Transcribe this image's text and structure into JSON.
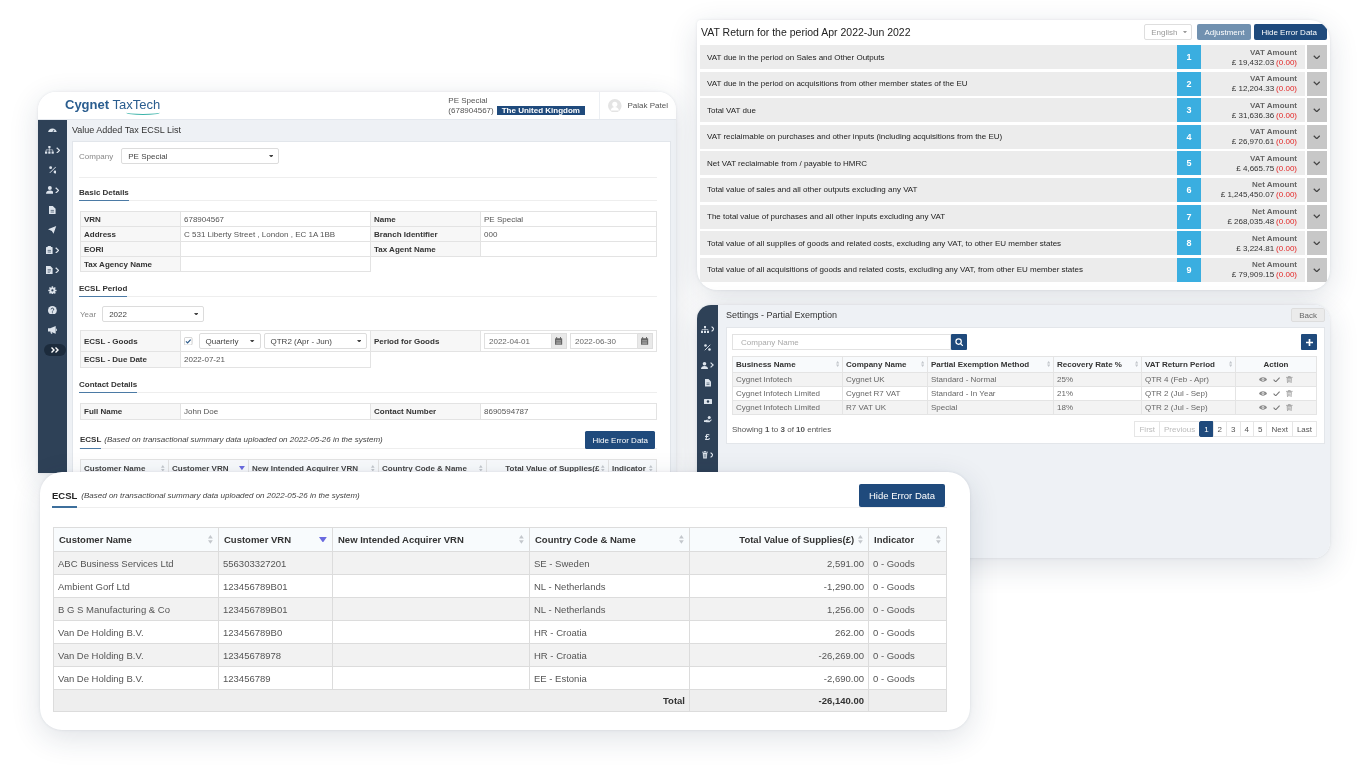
{
  "vat_return": {
    "title": "VAT Return for the period Apr 2022-Jun 2022",
    "language": "English",
    "buttons": [
      {
        "label": "Adjustment",
        "kind": "secondary"
      },
      {
        "label": "Hide Error Data",
        "kind": "primary"
      }
    ],
    "boxes": [
      {
        "description": "VAT due in the period on Sales and Other Outputs",
        "number": "1",
        "amount_label": "VAT Amount",
        "amount": "£ 19,432.03",
        "error": "(0.00)"
      },
      {
        "description": "VAT due in the period on acquisitions from other member states of the EU",
        "number": "2",
        "amount_label": "VAT Amount",
        "amount": "£ 12,204.33",
        "error": "(0.00)"
      },
      {
        "description": "Total VAT due",
        "number": "3",
        "amount_label": "VAT Amount",
        "amount": "£ 31,636.36",
        "error": "(0.00)"
      },
      {
        "description": "VAT reclaimable on purchases and other inputs (including acquisitions from the EU)",
        "number": "4",
        "amount_label": "VAT Amount",
        "amount": "£ 26,970.61",
        "error": "(0.00)"
      },
      {
        "description": "Net VAT reclaimable from / payable to HMRC",
        "number": "5",
        "amount_label": "VAT Amount",
        "amount": "£ 4,665.75",
        "error": "(0.00)"
      },
      {
        "description": "Total value of sales and all other outputs excluding any VAT",
        "number": "6",
        "amount_label": "Net Amount",
        "amount": "£ 1,245,450.07",
        "error": "(0.00)"
      },
      {
        "description": "The total value of purchases and all other inputs excluding any VAT",
        "number": "7",
        "amount_label": "Net Amount",
        "amount": "£ 268,035.48",
        "error": "(0.00)"
      },
      {
        "description": "Total value of all supplies of goods and related costs, excluding any VAT, to other EU member states",
        "number": "8",
        "amount_label": "Net Amount",
        "amount": "£ 3,224.81",
        "error": "(0.00)"
      },
      {
        "description": "Total value of all acquisitions of goods and related costs, excluding any VAT, from other EU member states",
        "number": "9",
        "amount_label": "Net Amount",
        "amount": "£ 79,909.15",
        "error": "(0.00)"
      }
    ]
  },
  "main_window": {
    "header": {
      "logo": "**Cygnet** TaxTech",
      "company": "PE Special",
      "company_id": "(678904567)",
      "country": "The United Kingdom",
      "user": "Palak Patel"
    },
    "sidebar": [
      {
        "kind": "gauge",
        "submenu": false
      },
      {
        "kind": "sitemap",
        "submenu": true
      },
      {
        "kind": "percent",
        "submenu": false
      },
      {
        "kind": "user",
        "submenu": true
      },
      {
        "kind": "document",
        "submenu": false
      },
      {
        "kind": "plane",
        "submenu": false
      },
      {
        "kind": "clipboard",
        "submenu": true
      },
      {
        "kind": "file",
        "submenu": true
      },
      {
        "kind": "gear",
        "submenu": false
      },
      {
        "kind": "help",
        "submenu": false
      },
      {
        "kind": "megaphone",
        "submenu": false
      },
      {
        "kind": "expand",
        "submenu": false
      }
    ],
    "title": "Value Added Tax ECSL List",
    "company": {
      "label": "Company",
      "value": "PE Special"
    },
    "basic_details": {
      "heading": "Basic Details",
      "fields": [
        {
          "label": "VRN",
          "value": "678904567"
        },
        {
          "label": "Name",
          "value": "PE Special"
        },
        {
          "label": "Address",
          "value": "C 531 Liberty Street , London , EC 1A 1BB"
        },
        {
          "label": "Branch Identifier",
          "value": "000"
        },
        {
          "label": "EORI"
        },
        {
          "label": "Tax Agent Name"
        },
        {
          "label": "Tax Agency Name"
        }
      ]
    },
    "ecsl_period": {
      "heading": "ECSL Period",
      "year": {
        "label": "Year",
        "value": "2022"
      },
      "goods": {
        "label": "ECSL - Goods",
        "checked": true,
        "frequency": "Quarterly",
        "quarter": "QTR2 (Apr - Jun)",
        "period_label": "Period for Goods",
        "from": "2022-04-01",
        "to": "2022-06-30"
      },
      "due_date": {
        "label": "ECSL - Due Date",
        "value": "2022-07-21"
      }
    },
    "contact_details": {
      "heading": "Contact Details",
      "fields": [
        {
          "label": "Full Name",
          "value": "John Doe"
        },
        {
          "label": "Contact Number",
          "value": "8690594787"
        }
      ]
    },
    "ecsl": {
      "heading": "ECSL",
      "note": "(Based on transactional summary data uploaded on 2022-05-26 in the system)",
      "button": "Hide Error Data",
      "columns": [
        {
          "label": "Customer Name",
          "sortable": true,
          "sorted": false
        },
        {
          "label": "Customer VRN",
          "sortable": true,
          "sorted": true
        },
        {
          "label": "New Intended Acquirer VRN",
          "sortable": true,
          "sorted": false
        },
        {
          "label": "Country Code & Name",
          "sortable": true,
          "sorted": false
        },
        {
          "label": "Total Value of Supplies(£",
          "sortable": true,
          "sorted": false
        },
        {
          "label": "Indicator",
          "sortable": true,
          "sorted": false
        }
      ]
    }
  },
  "partial_exemption": {
    "sidebar": [
      {
        "kind": "sitemap",
        "submenu": true
      },
      {
        "kind": "percent",
        "submenu": false
      },
      {
        "kind": "user",
        "submenu": true
      },
      {
        "kind": "document",
        "submenu": false
      },
      {
        "kind": "banknote",
        "submenu": false
      },
      {
        "kind": "hand",
        "submenu": false
      },
      {
        "kind": "glyph",
        "glyph": "£",
        "submenu": false
      },
      {
        "kind": "bin",
        "submenu": true
      }
    ],
    "title": "Settings - Partial Exemption",
    "back_button": "Back",
    "search": {
      "placeholder": "Company Name"
    },
    "columns": [
      {
        "label": "Business Name",
        "sortable": true,
        "sorted": false
      },
      {
        "label": "Company Name",
        "sortable": true,
        "sorted": false
      },
      {
        "label": "Partial Exemption Method",
        "sortable": true,
        "sorted": false
      },
      {
        "label": "Recovery Rate %",
        "sortable": true,
        "sorted": false
      },
      {
        "label": "VAT Return Period",
        "sortable": true,
        "sorted": false
      },
      {
        "label": "Action",
        "sortable": false,
        "sorted": false
      }
    ],
    "rows": [
      {
        "business_name": "Cygnet Infotech",
        "company_name": "Cygnet UK",
        "method": "Standard - Normal",
        "recovery_rate": "25%",
        "vat_return_period": "QTR 4 (Feb - Apr)"
      },
      {
        "business_name": "Cygnet Infotech Limited",
        "company_name": "Cygnet R7 VAT",
        "method": "Standard - In Year",
        "recovery_rate": "21%",
        "vat_return_period": "QTR 2 (Jul - Sep)"
      },
      {
        "business_name": "Cygnet Infotech Limited",
        "company_name": "R7 VAT UK",
        "method": "Special",
        "recovery_rate": "18%",
        "vat_return_period": "QTR 2 (Jul - Sep)"
      }
    ],
    "summary": "Showing **1** to **3** of **10** entries",
    "pagination": [
      {
        "label": "First",
        "selected": false,
        "disabled": true
      },
      {
        "label": "Previous",
        "selected": false,
        "disabled": true
      },
      {
        "label": "1",
        "selected": true,
        "disabled": false
      },
      {
        "label": "2",
        "selected": false,
        "disabled": false
      },
      {
        "label": "3",
        "selected": false,
        "disabled": false
      },
      {
        "label": "4",
        "selected": false,
        "disabled": false
      },
      {
        "label": "5",
        "selected": false,
        "disabled": false
      },
      {
        "label": "Next",
        "selected": false,
        "disabled": false
      },
      {
        "label": "Last",
        "selected": false,
        "disabled": false
      }
    ]
  },
  "ecsl_detail": {
    "heading": "ECSL",
    "note": "(Based on transactional summary data uploaded on 2022-05-26 in the system)",
    "button": "Hide Error Data",
    "columns": [
      {
        "label": "Customer Name",
        "sortable": true,
        "sorted": false
      },
      {
        "label": "Customer VRN",
        "sortable": true,
        "sorted": true
      },
      {
        "label": "New Intended Acquirer VRN",
        "sortable": true,
        "sorted": false
      },
      {
        "label": "Country Code & Name",
        "sortable": true,
        "sorted": false
      },
      {
        "label": "Total Value of Supplies(£)",
        "sortable": true,
        "sorted": false
      },
      {
        "label": "Indicator",
        "sortable": true,
        "sorted": false
      }
    ],
    "rows": [
      {
        "customer_name": "ABC Business Services Ltd",
        "customer_vrn": "556303327201",
        "country": "SE - Sweden",
        "total_value": "2,591.00",
        "indicator": "0 - Goods"
      },
      {
        "customer_name": "Ambient Gorf Ltd",
        "customer_vrn": "123456789B01",
        "country": "NL - Netherlands",
        "total_value": "-1,290.00",
        "indicator": "0 - Goods"
      },
      {
        "customer_name": "B G S Manufacturing & Co",
        "customer_vrn": "123456789B01",
        "country": "NL - Netherlands",
        "total_value": "1,256.00",
        "indicator": "0 - Goods"
      },
      {
        "customer_name": "Van De Holding B.V.",
        "customer_vrn": "123456789B0",
        "country": "HR - Croatia",
        "total_value": "262.00",
        "indicator": "0 - Goods"
      },
      {
        "customer_name": "Van De Holding B.V.",
        "customer_vrn": "12345678978",
        "country": "HR - Croatia",
        "total_value": "-26,269.00",
        "indicator": "0 - Goods"
      },
      {
        "customer_name": "Van De Holding B.V.",
        "customer_vrn": "123456789",
        "country": "EE - Estonia",
        "total_value": "-2,690.00",
        "indicator": "0 - Goods"
      }
    ],
    "total": {
      "label": "Total",
      "value": "-26,140.00"
    }
  }
}
